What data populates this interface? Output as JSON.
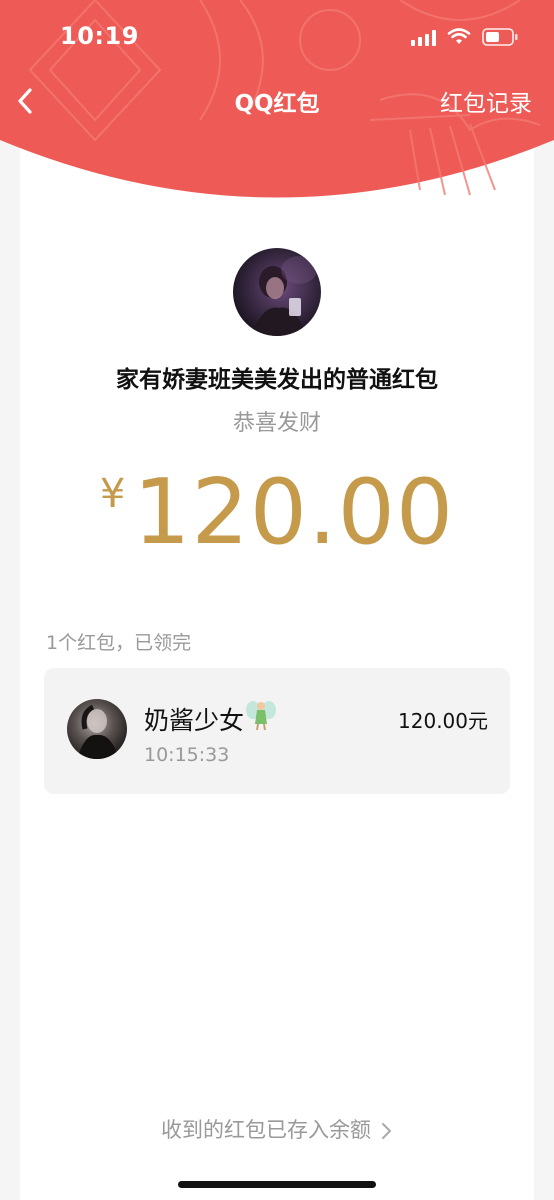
{
  "status_bar": {
    "time": "10:19"
  },
  "nav": {
    "title": "QQ红包",
    "right_label": "红包记录"
  },
  "packet": {
    "sender_line": "家有娇妻班美美发出的普通红包",
    "greeting": "恭喜发财",
    "currency": "¥",
    "amount": "120.00"
  },
  "summary": "1个红包，已领完",
  "records": [
    {
      "name": "奶酱少女",
      "time": "10:15:33",
      "amount": "120.00元",
      "emoji": "fairy-emoji"
    }
  ],
  "footer": {
    "link_label": "收到的红包已存入余额"
  },
  "colors": {
    "header_red": "#ee5a55",
    "gold": "#c59a4b"
  }
}
